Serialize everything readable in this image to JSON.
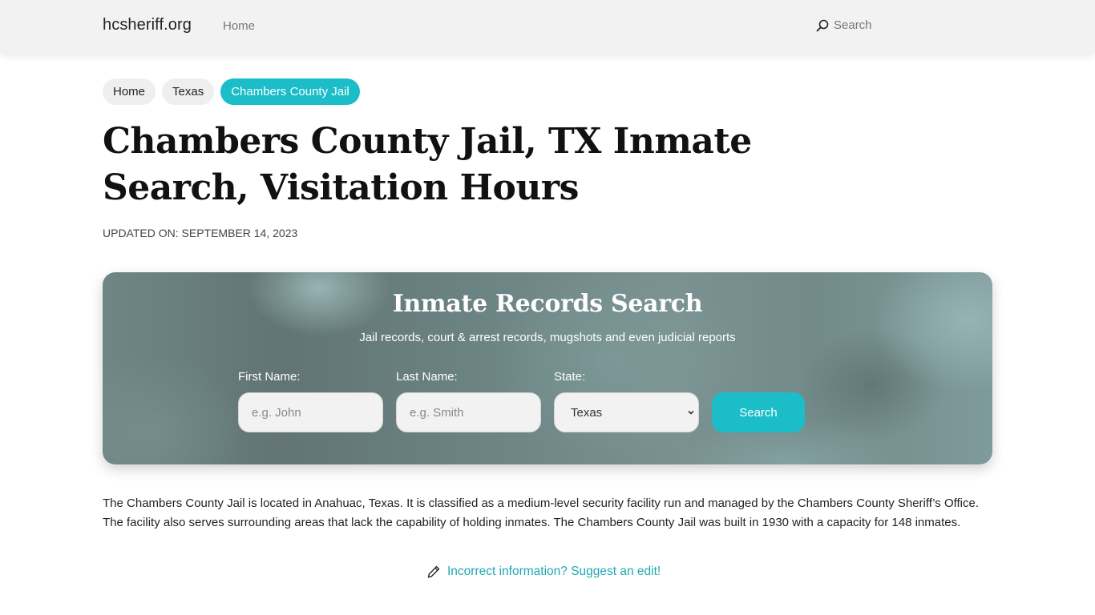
{
  "navbar": {
    "brand": "hcsheriff.org",
    "links": [
      {
        "label": "Home"
      }
    ],
    "search_label": "Search",
    "search_icon": "search-icon"
  },
  "breadcrumb": [
    {
      "label": "Home",
      "active": false
    },
    {
      "label": "Texas",
      "active": false
    },
    {
      "label": "Chambers County Jail",
      "active": true
    }
  ],
  "page": {
    "title": "Chambers County Jail, TX Inmate Search, Visitation Hours",
    "updated": "UPDATED ON: SEPTEMBER 14, 2023"
  },
  "search_panel": {
    "title": "Inmate Records Search",
    "subtitle": "Jail records, court & arrest records, mugshots and even judicial reports",
    "first_name": {
      "label": "First Name:",
      "placeholder": "e.g. John",
      "value": ""
    },
    "last_name": {
      "label": "Last Name:",
      "placeholder": "e.g. Smith",
      "value": ""
    },
    "state": {
      "label": "State:",
      "selected": "Texas"
    },
    "button_label": "Search"
  },
  "content": {
    "intro": "The Chambers County Jail is located in Anahuac, Texas. It is classified as a medium-level security facility run and managed by the Chambers County Sheriff’s Office. The facility also serves surrounding areas that lack the capability of holding inmates. The Chambers County Jail was built in 1930 with a capacity for 148 inmates.",
    "suggest_edit": "Incorrect information? Suggest an edit!",
    "suggest_icon": "pencil-icon"
  },
  "colors": {
    "accent": "#1bbdc8",
    "link": "#1fa9b5",
    "navbar_bg": "#f2f2f2"
  }
}
